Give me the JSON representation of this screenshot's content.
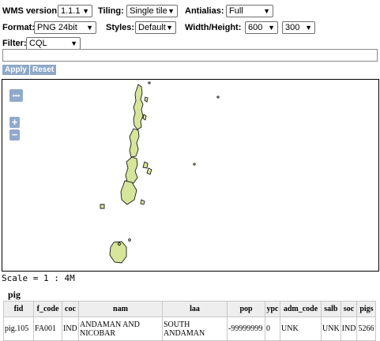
{
  "controls": {
    "wms_version": {
      "label": "WMS version:",
      "value": "1.1.1"
    },
    "tiling": {
      "label": "Tiling:",
      "value": "Single tile"
    },
    "antialias": {
      "label": "Antialias:",
      "value": "Full"
    },
    "format": {
      "label": "Format:",
      "value": "PNG 24bit"
    },
    "styles": {
      "label": "Styles:",
      "value": "Default"
    },
    "width_height": {
      "label": "Width/Height:",
      "width": "600",
      "height": "300"
    },
    "filter": {
      "label": "Filter:",
      "value": "CQL",
      "query": ""
    }
  },
  "buttons": {
    "apply": "Apply",
    "reset": "Reset"
  },
  "map": {
    "pan_label": "•••",
    "zoom_in": "+",
    "zoom_out": "−",
    "fill_color": "#d6e59a",
    "stroke_color": "#1a1a1a"
  },
  "scale_text": "Scale = 1 : 4M",
  "feature_info": {
    "layer": "pig",
    "columns": [
      "fid",
      "f_code",
      "coc",
      "nam",
      "laa",
      "pop",
      "ypc",
      "adm_code",
      "salb",
      "soc",
      "pigs"
    ],
    "rows": [
      [
        "pig.105",
        "FA001",
        "IND",
        "ANDAMAN AND NICOBAR",
        "SOUTH ANDAMAN",
        "-99999999",
        "0",
        "UNK",
        "UNK",
        "IND",
        "5266"
      ]
    ]
  },
  "colors": {
    "button_bg": "#8ea8c6",
    "map_tool_bg": "#90a9cc",
    "header_bg": "#eeeeee"
  }
}
